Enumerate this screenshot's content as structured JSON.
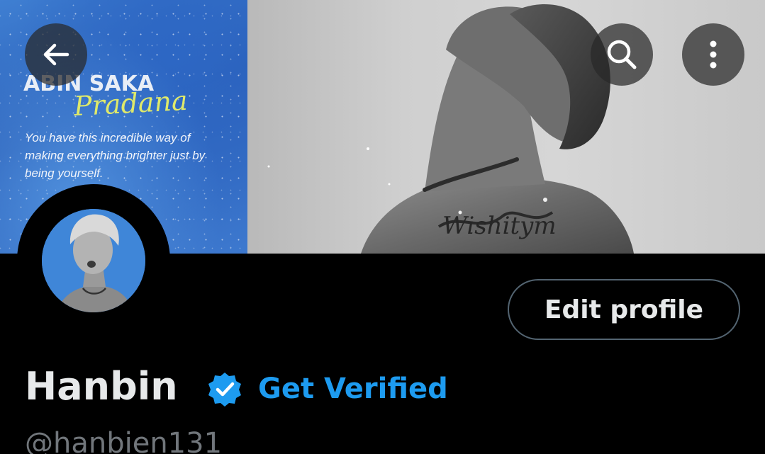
{
  "header": {
    "back_icon": "arrow-left-icon",
    "search_icon": "search-icon",
    "more_icon": "more-vertical-icon"
  },
  "banner": {
    "promo_title": "ABIN SAKA",
    "promo_script": "Pradana",
    "promo_text": "You have this incredible way of making everything brighter just by being yourself.",
    "tattoo_text": "Wishitym"
  },
  "profile": {
    "edit_label": "Edit profile",
    "display_name": "Hanbin",
    "verified_icon": "verified-badge-icon",
    "get_verified_label": "Get Verified",
    "handle": "@hanbien131"
  },
  "colors": {
    "background": "#000000",
    "accent": "#1d9bf0",
    "text_primary": "#e7e9ea",
    "text_secondary": "#71767b",
    "button_border": "#536471"
  }
}
